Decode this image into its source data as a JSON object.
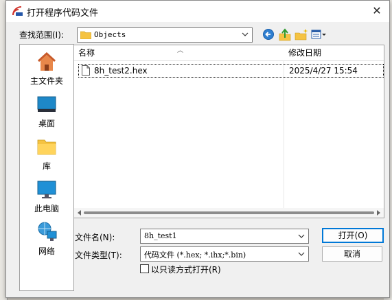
{
  "window": {
    "title": "打开程序代码文件",
    "close_glyph": "✕"
  },
  "lookin": {
    "label": "查找范围(I):",
    "value": "Objects"
  },
  "places": [
    {
      "label": "主文件夹",
      "icon": "home-icon"
    },
    {
      "label": "桌面",
      "icon": "desktop-icon"
    },
    {
      "label": "库",
      "icon": "library-folder-icon"
    },
    {
      "label": "此电脑",
      "icon": "computer-icon"
    },
    {
      "label": "网络",
      "icon": "network-icon"
    }
  ],
  "filelist": {
    "col_name": "名称",
    "col_date": "修改日期",
    "files": [
      {
        "name": "8h_test2.hex",
        "date": "2025/4/27 15:54"
      }
    ]
  },
  "filename": {
    "label": "文件名(N):",
    "value": "8h_test1"
  },
  "filetype": {
    "label": "文件类型(T):",
    "value": "代码文件 (*.hex;  *.ihx;*.bin)"
  },
  "readonly": {
    "label": "以只读方式打开(R)",
    "checked": false
  },
  "buttons": {
    "open": "打开(O)",
    "cancel": "取消"
  },
  "colors": {
    "accent": "#0078d7",
    "folder": "#f5c342",
    "desktop": "#1e88c8"
  }
}
